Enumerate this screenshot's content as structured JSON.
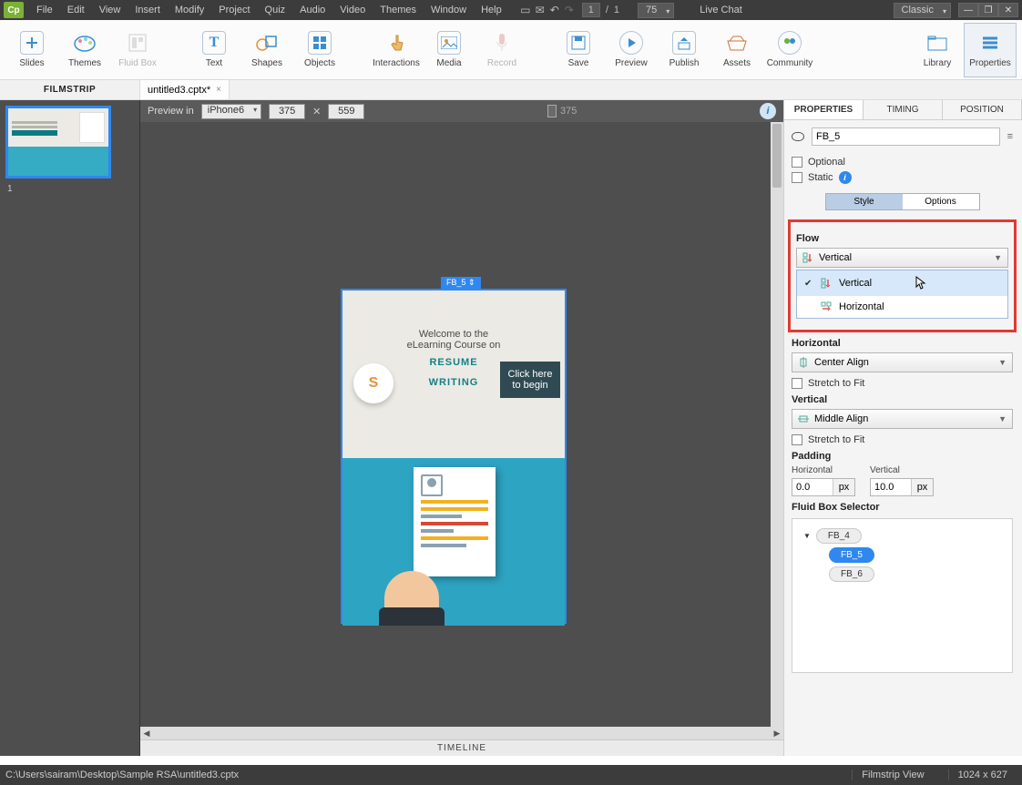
{
  "menubar": {
    "items": [
      "File",
      "Edit",
      "View",
      "Insert",
      "Modify",
      "Project",
      "Quiz",
      "Audio",
      "Video",
      "Themes",
      "Window",
      "Help"
    ],
    "page_current": "1",
    "page_sep": "/",
    "page_total": "1",
    "zoom": "75",
    "live_chat": "Live Chat",
    "workspace": "Classic"
  },
  "ribbon": {
    "items": [
      {
        "label": "Slides",
        "icon": "plus"
      },
      {
        "label": "Themes",
        "icon": "palette"
      },
      {
        "label": "Fluid Box",
        "icon": "fluid",
        "dis": true
      },
      {
        "label": "Text",
        "icon": "text"
      },
      {
        "label": "Shapes",
        "icon": "shapes"
      },
      {
        "label": "Objects",
        "icon": "grid"
      },
      {
        "label": "Interactions",
        "icon": "hand"
      },
      {
        "label": "Media",
        "icon": "image"
      },
      {
        "label": "Record",
        "icon": "mic",
        "dis": true
      },
      {
        "label": "Save",
        "icon": "save"
      },
      {
        "label": "Preview",
        "icon": "play"
      },
      {
        "label": "Publish",
        "icon": "upload"
      },
      {
        "label": "Assets",
        "icon": "box"
      },
      {
        "label": "Community",
        "icon": "people"
      }
    ],
    "right": [
      {
        "label": "Library",
        "icon": "folder"
      },
      {
        "label": "Properties",
        "icon": "list",
        "sel": true
      }
    ]
  },
  "tabstrip": {
    "filmstrip_label": "FILMSTRIP",
    "doc_name": "untitled3.cptx*"
  },
  "filmstrip": {
    "thumb_number": "1"
  },
  "previewbar": {
    "label": "Preview in",
    "device": "iPhone6",
    "w": "375",
    "h": "559",
    "ruler_val": "375"
  },
  "stage": {
    "fb_tag": "FB_5 ⇕",
    "welcome_l1": "Welcome to the",
    "welcome_l2": "eLearning Course on",
    "title_l1": "RESUME",
    "title_l2": "WRITING",
    "cta_l1": "Click here",
    "cta_l2": "to begin"
  },
  "timeline_label": "TIMELINE",
  "props": {
    "tabs": [
      "PROPERTIES",
      "TIMING",
      "POSITION"
    ],
    "name": "FB_5",
    "optional": "Optional",
    "static": "Static",
    "subtabs": [
      "Style",
      "Options"
    ],
    "flow_label": "Flow",
    "flow_value": "Vertical",
    "flow_options": [
      "Vertical",
      "Horizontal"
    ],
    "horizontal_label": "Horizontal",
    "horizontal_value": "Center Align",
    "h_stretch": "Stretch to Fit",
    "vertical_label": "Vertical",
    "vertical_value": "Middle Align",
    "v_stretch": "Stretch to Fit",
    "padding_label": "Padding",
    "pad_h_label": "Horizontal",
    "pad_v_label": "Vertical",
    "pad_h_val": "0.0",
    "pad_v_val": "10.0",
    "pad_unit": "px",
    "fbsel_label": "Fluid Box Selector",
    "fbsel_nodes": [
      "FB_4",
      "FB_5",
      "FB_6"
    ]
  },
  "statusbar": {
    "path": "C:\\Users\\sairam\\Desktop\\Sample RSA\\untitled3.cptx",
    "view": "Filmstrip View",
    "dims": "1024 x 627"
  }
}
